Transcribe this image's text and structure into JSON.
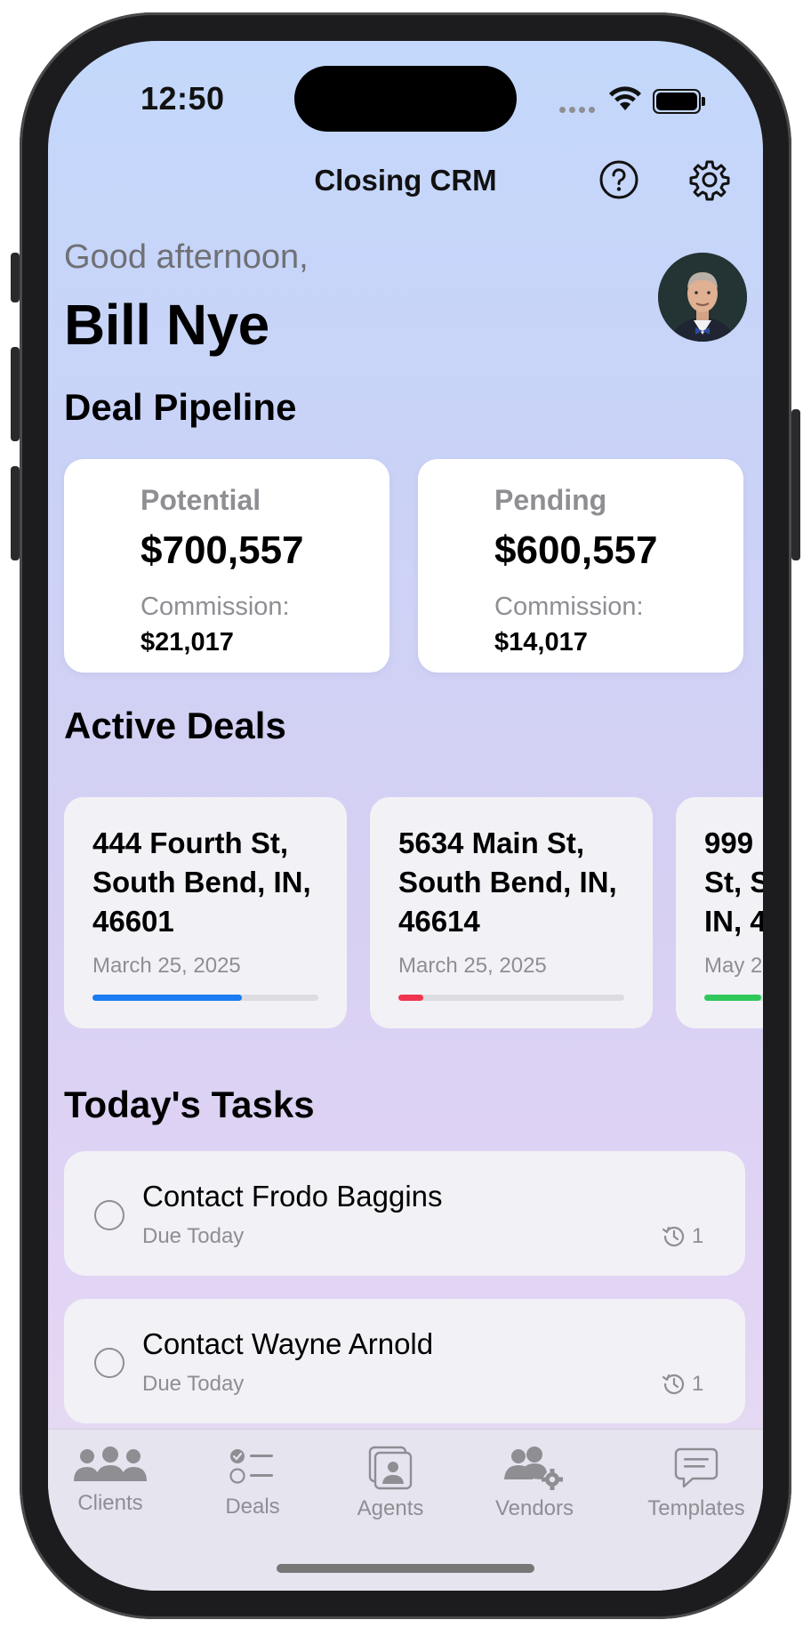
{
  "status_bar": {
    "time": "12:50"
  },
  "header": {
    "title": "Closing CRM",
    "help_icon": "question-circle-icon",
    "settings_icon": "gear-icon"
  },
  "greeting": {
    "text": "Good afternoon,",
    "name": "Bill Nye"
  },
  "pipeline": {
    "title": "Deal Pipeline",
    "cards": [
      {
        "label": "Potential",
        "amount": "$700,557",
        "commission_label": "Commission:",
        "commission": "$21,017"
      },
      {
        "label": "Pending",
        "amount": "$600,557",
        "commission_label": "Commission:",
        "commission": "$14,017"
      }
    ]
  },
  "active_deals": {
    "title": "Active Deals",
    "deals": [
      {
        "address": "444 Fourth St,\nSouth Bend, IN,\n46601",
        "date": "March 25, 2025",
        "progress": 0.66,
        "color": "#1a7cf0"
      },
      {
        "address": "5634 Main St,\nSouth Bend, IN,\n46614",
        "date": "March 25, 2025",
        "progress": 0.11,
        "color": "#f0344f"
      },
      {
        "address": "999\nSt, S\nIN, 4",
        "date": "May 2",
        "progress": 0.25,
        "color": "#2fc85a"
      }
    ]
  },
  "tasks": {
    "title": "Today's Tasks",
    "items": [
      {
        "name": "Contact Frodo Baggins",
        "due": "Due Today",
        "count": "1"
      },
      {
        "name": "Contact Wayne Arnold",
        "due": "Due Today",
        "count": "1"
      }
    ]
  },
  "tabbar": {
    "items": [
      {
        "label": "Clients",
        "icon": "people-icon"
      },
      {
        "label": "Deals",
        "icon": "checklist-icon"
      },
      {
        "label": "Agents",
        "icon": "person-photo-icon"
      },
      {
        "label": "Vendors",
        "icon": "people-gear-icon"
      },
      {
        "label": "Templates",
        "icon": "message-icon"
      }
    ]
  }
}
